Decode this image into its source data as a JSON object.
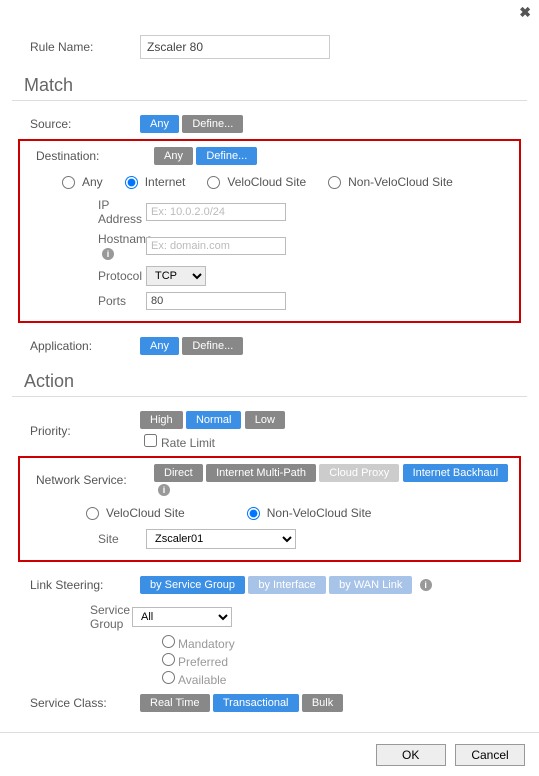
{
  "ruleName": {
    "label": "Rule Name:",
    "value": "Zscaler 80"
  },
  "sections": {
    "match": "Match",
    "action": "Action"
  },
  "match": {
    "source": {
      "label": "Source:",
      "any": "Any",
      "define": "Define..."
    },
    "destination": {
      "label": "Destination:",
      "any": "Any",
      "define": "Define...",
      "radios": {
        "any": "Any",
        "internet": "Internet",
        "velo": "VeloCloud Site",
        "nonvelo": "Non-VeloCloud Site"
      },
      "ipLabel": "IP Address",
      "ipPh": "Ex: 10.0.2.0/24",
      "hostLabel": "Hostname",
      "hostPh": "Ex: domain.com",
      "protoLabel": "Protocol",
      "protoVal": "TCP",
      "portsLabel": "Ports",
      "portsVal": "80"
    },
    "application": {
      "label": "Application:",
      "any": "Any",
      "define": "Define..."
    }
  },
  "action": {
    "priority": {
      "label": "Priority:",
      "high": "High",
      "normal": "Normal",
      "low": "Low",
      "rateLimit": "Rate Limit"
    },
    "netsvc": {
      "label": "Network Service:",
      "direct": "Direct",
      "imp": "Internet Multi-Path",
      "cloud": "Cloud Proxy",
      "backhaul": "Internet Backhaul",
      "velo": "VeloCloud Site",
      "nonvelo": "Non-VeloCloud Site",
      "siteLabel": "Site",
      "siteVal": "Zscaler01"
    },
    "link": {
      "label": "Link Steering:",
      "bySvc": "by Service Group",
      "byIf": "by Interface",
      "byWan": "by WAN Link",
      "sgLabel": "Service Group",
      "sgVal": "All",
      "mandatory": "Mandatory",
      "preferred": "Preferred",
      "available": "Available"
    },
    "svcClass": {
      "label": "Service Class:",
      "rt": "Real Time",
      "trans": "Transactional",
      "bulk": "Bulk"
    }
  },
  "footer": {
    "ok": "OK",
    "cancel": "Cancel"
  }
}
